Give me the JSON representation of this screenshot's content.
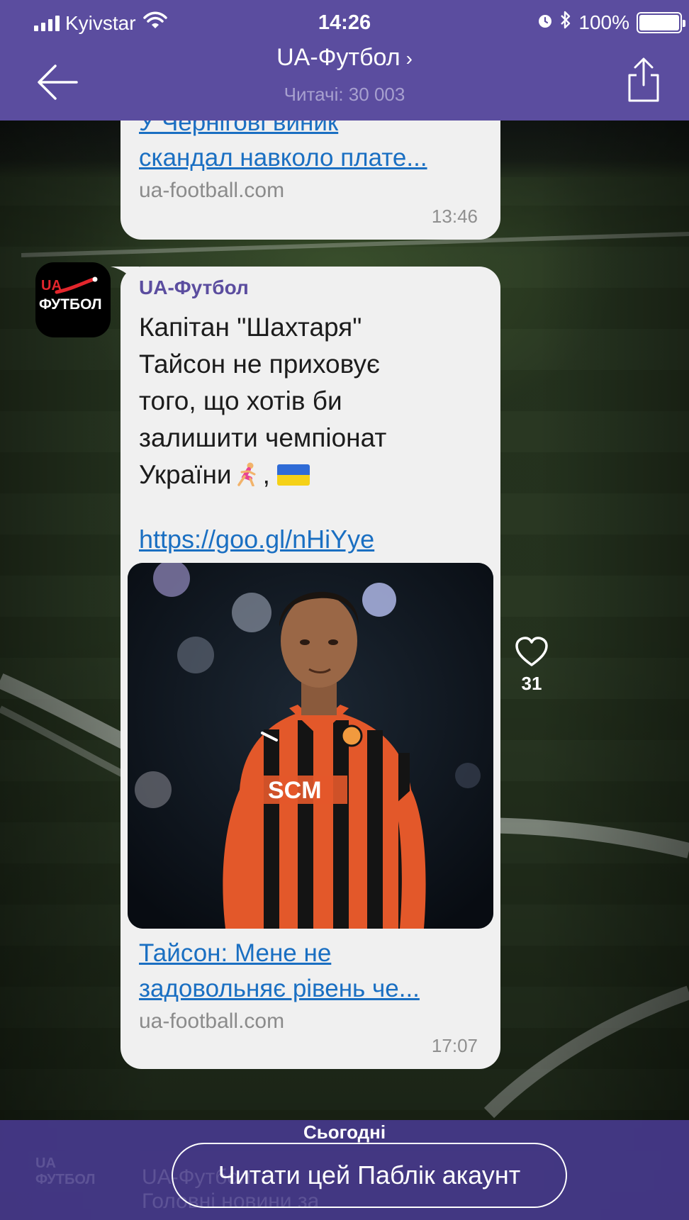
{
  "status_bar": {
    "carrier": "Kyivstar",
    "time": "14:26",
    "battery": "100%"
  },
  "header": {
    "title": "UA-Футбол",
    "title_chevron": "›",
    "subtitle": "Читачі: 30 003"
  },
  "previous_message": {
    "link_title_line1": "У Чернігові виник",
    "link_title_line2": "скандал навколо плате...",
    "domain": "ua-football.com",
    "time": "13:46"
  },
  "avatar": {
    "logo_top": "UA",
    "logo_bottom": "ФУТБОЛ"
  },
  "message": {
    "sender": "UA-Футбол",
    "text_lines": [
      "Капітан \"Шахтаря\"",
      "Тайсон не приховує",
      "того, що хотів би",
      "залишити чемпіонат",
      "України"
    ],
    "text_trailing_comma": ",",
    "url": "https://goo.gl/nHiYye",
    "preview": {
      "title_line1": "Тайсон: Мене не",
      "title_line2": "задовольняє рівень че...",
      "domain": "ua-football.com"
    },
    "time": "17:07",
    "likes": "31"
  },
  "date_separator": "Сьогодні",
  "bottom_bar": {
    "read_button_label": "Читати цей Паблік акаунт",
    "ghost_sender": "UA-Футбол",
    "ghost_text": "Головні новини за"
  },
  "colors": {
    "header_bg": "#5b4d9f",
    "bubble_bg": "#f0f0f0",
    "link": "#1a6fc2",
    "sender": "#5b4d9f",
    "bottom_bar": "#463a8c"
  },
  "icons": {
    "back": "arrow-left-icon",
    "share": "share-icon",
    "like": "heart-icon",
    "wifi": "wifi-icon",
    "alarm": "alarm-icon",
    "bluetooth": "bluetooth-icon"
  }
}
